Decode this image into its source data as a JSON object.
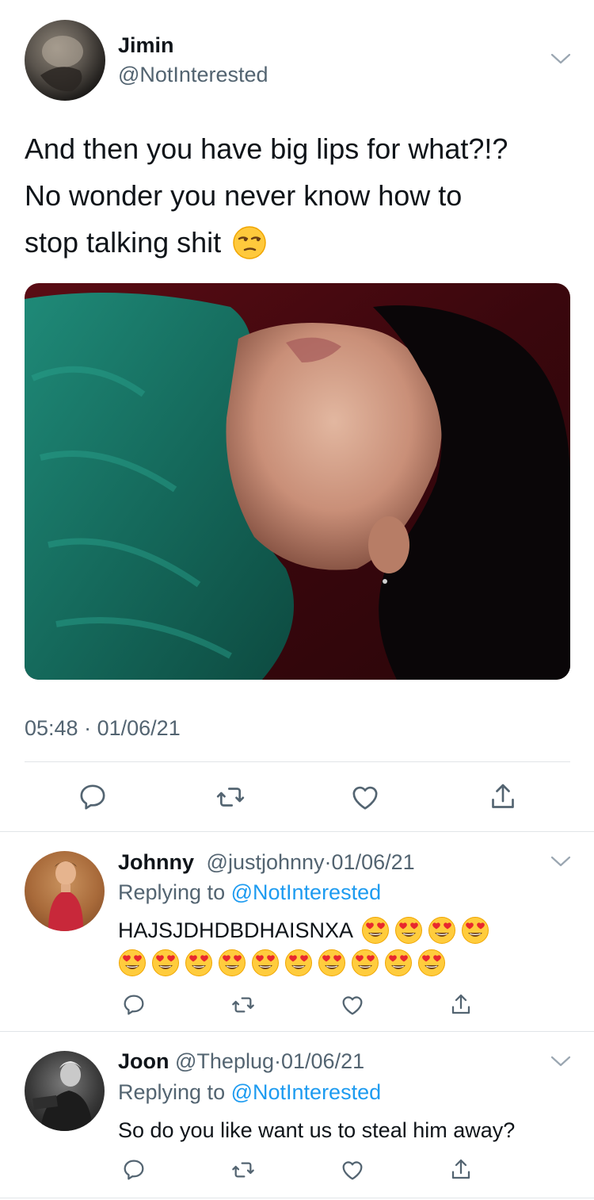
{
  "main_tweet": {
    "name": "Jimin",
    "handle": "@NotInterested",
    "text_lines": [
      "And then you have big lips for what?!?",
      "No wonder you never know how to",
      "stop talking shit"
    ],
    "time": "05:48",
    "dot": "·",
    "date": "01/06/21"
  },
  "replies": [
    {
      "name": "Johnny",
      "handle": "@justjohnny",
      "dot": "·",
      "date": "01/06/21",
      "replying_prefix": "Replying to",
      "replying_to": "@NotInterested",
      "text": "HAJSJDHDBDHAISNXA",
      "emoji_count_line1": 4,
      "emoji_count_line2": 10
    },
    {
      "name": "Joon",
      "handle": "@Theplug",
      "dot": "·",
      "date": "01/06/21",
      "replying_prefix": "Replying to",
      "replying_to": "@NotInterested",
      "text": "So do you like want us to steal him away?"
    }
  ],
  "icons": {
    "reply": "speech-bubble-icon",
    "retweet": "retweet-icon",
    "like": "heart-icon",
    "share": "share-icon",
    "more": "chevron-down-icon",
    "unamused": "unamused-face-emoji",
    "heart_eyes": "heart-eyes-emoji"
  },
  "colors": {
    "link": "#1d9bf0",
    "secondary_text": "#536471",
    "divider": "#e1e5e8"
  }
}
